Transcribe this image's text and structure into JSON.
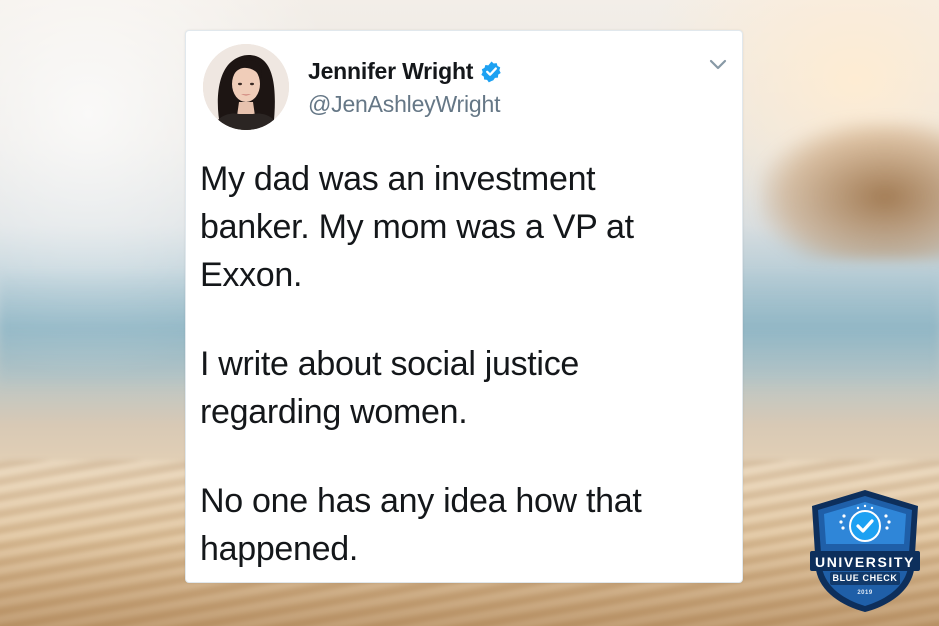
{
  "tweet": {
    "display_name": "Jennifer Wright",
    "handle": "@JenAshleyWright",
    "verified": true,
    "paragraphs": [
      "My dad was an investment\nbanker. My mom was a VP at\nExxon.",
      "I write about social justice\nregarding women.",
      "No one has any idea how that\nhappened."
    ]
  },
  "badge": {
    "title": "UNIVERSITY",
    "subtitle": "BLUE CHECK",
    "year": "2019"
  },
  "colors": {
    "verified_blue": "#1da1f2",
    "badge_dark": "#123a6b",
    "badge_mid": "#1f5fa8",
    "badge_light": "#2f86d8"
  },
  "icons": {
    "verified": "verified-badge-icon",
    "menu": "chevron-down-icon",
    "badge_check": "check-icon"
  }
}
